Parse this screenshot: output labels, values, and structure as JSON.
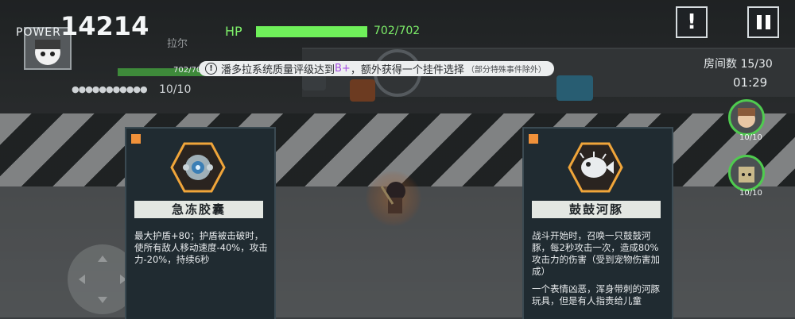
{
  "hud": {
    "power_label": "POWER",
    "power_value": "14214",
    "hp_label": "HP",
    "hp_value": "702/702",
    "hp_fraction": 1.0,
    "alert_icon": "exclamation-icon",
    "pause_icon": "pause-icon"
  },
  "player_panel": {
    "ally_name": "拉尔",
    "ally_hp": "702/702",
    "ammo_dots": "●●●●●●●●●●●",
    "ammo_count": "10/10"
  },
  "notice": {
    "prefix": "潘多拉系统质量评级达到",
    "grade": "B+",
    "suffix": "，额外获得一个挂件选择",
    "note": "（部分特殊事件除外）"
  },
  "room": {
    "label": "房间数",
    "count": "15/30",
    "timer": "01:29"
  },
  "ring_timer": "01:29",
  "allies": [
    {
      "level": "10/10"
    },
    {
      "level": "10/10"
    }
  ],
  "cards": [
    {
      "name": "急冻胶囊",
      "icon": "frozen-capsule-icon",
      "description": "最大护盾+80；护盾被击破时，使所有敌人移动速度-40%，攻击力-20%，持续6秒",
      "lore": ""
    },
    {
      "name": "鼓鼓河豚",
      "icon": "pufferfish-icon",
      "description": "战斗开始时，召唤一只鼓鼓河豚，每2秒攻击一次，造成80%攻击力的伤害（受到宠物伤害加成）",
      "lore": "一个表情凶恶，浑身带刺的河豚玩具，但是有人指责给儿童"
    }
  ],
  "colors": {
    "hp_green": "#6ff05a",
    "card_bg": "#202b31",
    "card_marker": "#f0913a",
    "hex_border": "#f0a53a",
    "grade_purple": "#a54ee0"
  }
}
